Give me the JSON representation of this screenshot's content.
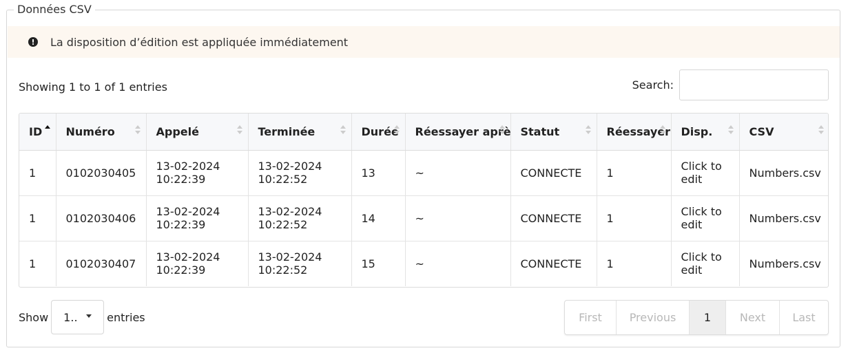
{
  "legend": "Données CSV",
  "alert": {
    "icon": "exclamation-circle-icon",
    "text": "La disposition d’édition est appliquée immédiatement"
  },
  "info": "Showing 1 to 1 of 1 entries",
  "search": {
    "label": "Search:",
    "placeholder": "",
    "value": ""
  },
  "table": {
    "columns": [
      "ID",
      "Numéro",
      "Appelé",
      "Terminée",
      "Durée",
      "Réessayer après",
      "Statut",
      "Réessayer",
      "Disp.",
      "CSV"
    ],
    "rows": [
      [
        "1",
        "0102030405",
        "13-02-2024 10:22:39",
        "13-02-2024 10:22:52",
        "13",
        "~",
        "CONNECTE",
        "1",
        "Click to edit",
        "Numbers.csv"
      ],
      [
        "1",
        "0102030406",
        "13-02-2024 10:22:39",
        "13-02-2024 10:22:52",
        "14",
        "~",
        "CONNECTE",
        "1",
        "Click to edit",
        "Numbers.csv"
      ],
      [
        "1",
        "0102030407",
        "13-02-2024 10:22:39",
        "13-02-2024 10:22:52",
        "15",
        "~",
        "CONNECTE",
        "1",
        "Click to edit",
        "Numbers.csv"
      ]
    ]
  },
  "length": {
    "show_label": "Show",
    "selected": "1..",
    "entries_label": "entries"
  },
  "pagination": {
    "first": "First",
    "previous": "Previous",
    "current": "1",
    "next": "Next",
    "last": "Last"
  },
  "colors": {
    "alert_bg": "#fdf7f0",
    "active_page_bg": "#eeeeee",
    "disabled_text": "#b8b8b8"
  }
}
